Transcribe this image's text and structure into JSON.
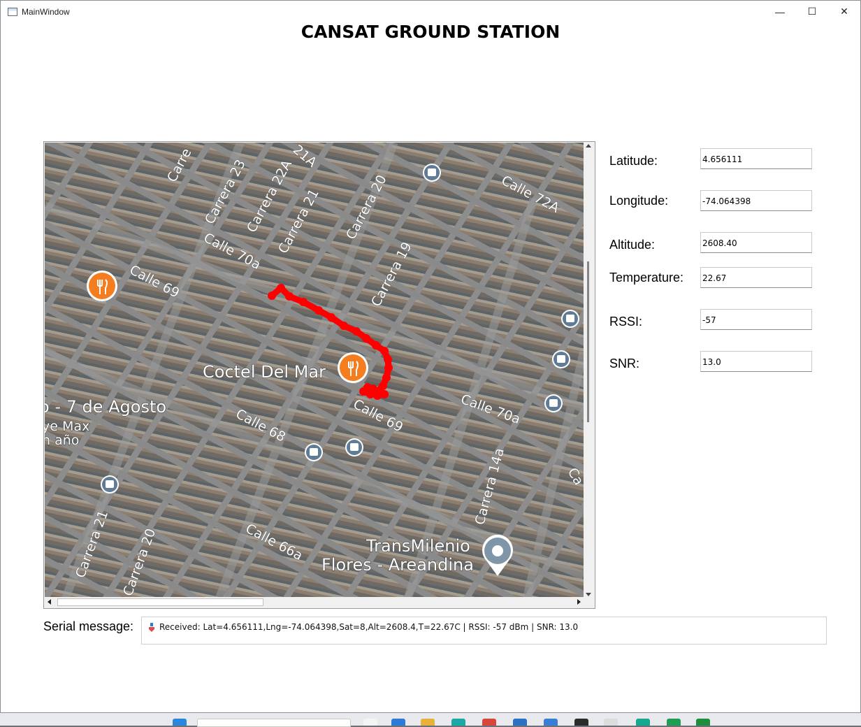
{
  "window": {
    "title": "MainWindow",
    "controls": {
      "minimize": "—",
      "maximize": "☐",
      "close": "✕"
    }
  },
  "app": {
    "title": "CANSAT GROUND STATION"
  },
  "map": {
    "streets": [
      "Carrera 23",
      "Carrera 22A",
      "Carrera 21",
      "Carrera 20",
      "Carrera 19",
      "Calle 72A",
      "Calle 70a",
      "Calle 69",
      "Calle 69",
      "Calle 70a",
      "Calle 68",
      "Calle 66a",
      "Carrera 14a",
      "Carrera 21",
      "Carrera 20",
      "Carre",
      "21A",
      "Ca"
    ],
    "places": [
      "Coctel Del Mar",
      "o - 7 de Agosto",
      "ye Max",
      "n año",
      "TransMilenio",
      "Flores - Areandina"
    ],
    "trajectory_color": "#ff0000",
    "icons": [
      "restaurant-icon",
      "bus-stop-icon",
      "transit-station-icon"
    ]
  },
  "telemetry": {
    "latitude": {
      "label": "Latitude:",
      "value": "4.656111"
    },
    "longitude": {
      "label": "Longitude:",
      "value": "-74.064398"
    },
    "altitude": {
      "label": "Altitude:",
      "value": "2608.40"
    },
    "temperature": {
      "label": "Temperature:",
      "value": "22.67"
    },
    "rssi": {
      "label": "RSSI:",
      "value": "-57"
    },
    "snr": {
      "label": "SNR:",
      "value": "13.0"
    }
  },
  "serial": {
    "label": "Serial message:",
    "message": "Received: Lat=4.656111,Lng=-74.064398,Sat=8,Alt=2608.4,T=22.67C | RSSI: -57 dBm | SNR: 13.0"
  },
  "colors": {
    "trajectory": "#ff0000",
    "restaurant_pin": "#f47d20",
    "bus_icon": "#5f7b96"
  }
}
